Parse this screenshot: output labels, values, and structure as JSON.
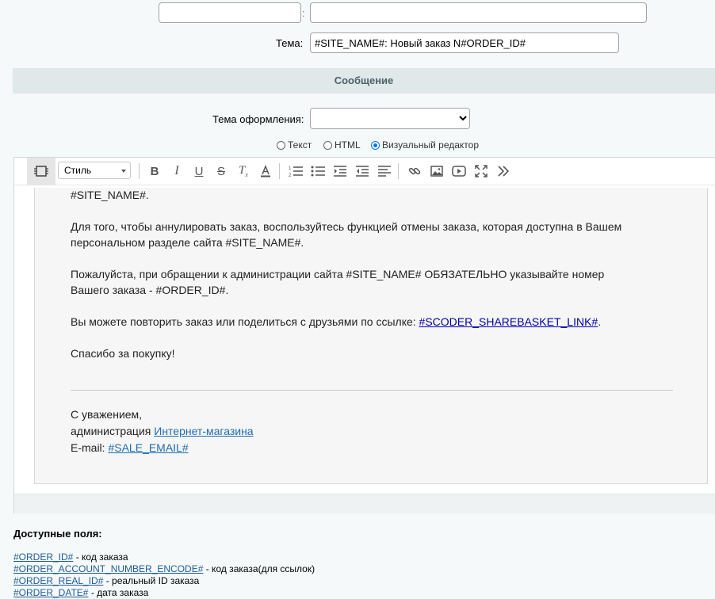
{
  "top_fields": {
    "field1_value": "",
    "separator": ":",
    "field2_value": ""
  },
  "subject": {
    "label": "Тема:",
    "value": "#SITE_NAME#: Новый заказ N#ORDER_ID#"
  },
  "section_title": "Сообщение",
  "theme": {
    "label": "Тема оформления:",
    "selected": ""
  },
  "format_options": [
    {
      "label": "Текст",
      "checked": false
    },
    {
      "label": "HTML",
      "checked": false
    },
    {
      "label": "Визуальный редактор",
      "checked": true
    }
  ],
  "toolbar": {
    "style_label": "Стиль",
    "buttons": [
      "source-icon",
      "bold-icon",
      "italic-icon",
      "underline-icon",
      "strikethrough-icon",
      "remove-format-icon",
      "font-color-icon",
      "ordered-list-icon",
      "unordered-list-icon",
      "indent-icon",
      "outdent-icon",
      "align-icon",
      "link-icon",
      "image-icon",
      "video-icon",
      "fullscreen-icon",
      "more-icon"
    ]
  },
  "message": {
    "line1": "#SITE_NAME#.",
    "para1": "Для того, чтобы аннулировать заказ, воспользуйтесь функцией отмены заказа, которая доступна в Вашем персональном разделе сайта #SITE_NAME#.",
    "para2": "Пожалуйста, при обращении к администрации сайта #SITE_NAME# ОБЯЗАТЕЛЬНО указывайте номер Вашего заказа - #ORDER_ID#.",
    "para3_text": "Вы можете повторить заказ или поделиться с друзьями по ссылке: ",
    "para3_link": "#SCODER_SHAREBASKET_LINK#",
    "para3_end": ".",
    "thanks": "Спасибо за покупку!",
    "sig1": "С уважением,",
    "sig2_text": "администрация ",
    "sig2_link": "Интернет-магазина",
    "sig3_text": "E-mail: ",
    "sig3_link": "#SALE_EMAIL#"
  },
  "available_fields": {
    "title": "Доступные поля:",
    "items": [
      {
        "code": "#ORDER_ID#",
        "desc": " - код заказа"
      },
      {
        "code": "#ORDER_ACCOUNT_NUMBER_ENCODE#",
        "desc": " - код заказа(для ссылок)"
      },
      {
        "code": "#ORDER_REAL_ID#",
        "desc": " - реальный ID заказа"
      },
      {
        "code": "#ORDER_DATE#",
        "desc": " - дата заказа"
      }
    ]
  }
}
